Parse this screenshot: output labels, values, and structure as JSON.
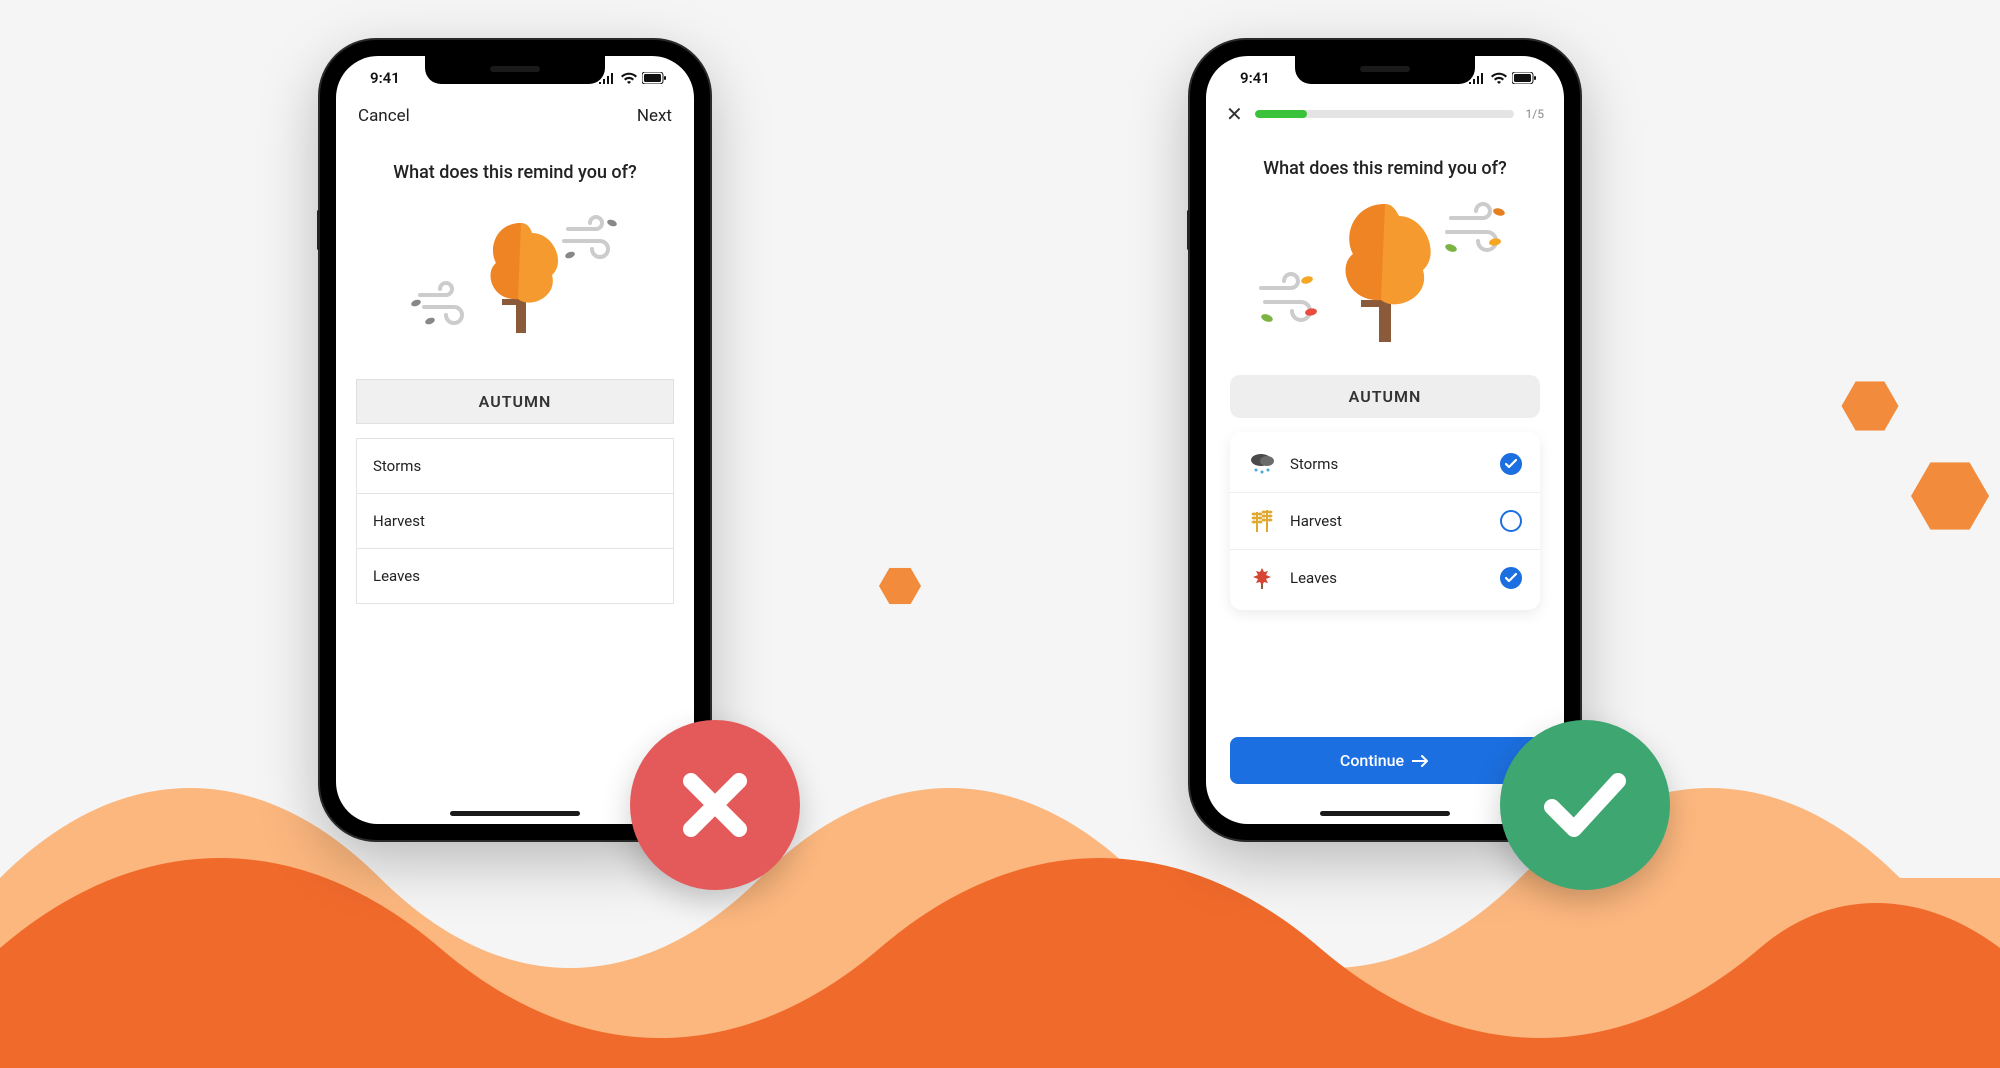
{
  "status": {
    "time": "9:41"
  },
  "left": {
    "nav": {
      "cancel": "Cancel",
      "next": "Next"
    },
    "question": "What does this remind you of?",
    "section": "AUTUMN",
    "options": [
      {
        "label": "Storms"
      },
      {
        "label": "Harvest"
      },
      {
        "label": "Leaves"
      }
    ]
  },
  "right": {
    "progress": {
      "label": "1/5",
      "percent": 20
    },
    "question": "What does this remind you of?",
    "section": "AUTUMN",
    "options": [
      {
        "label": "Storms",
        "checked": true
      },
      {
        "label": "Harvest",
        "checked": false
      },
      {
        "label": "Leaves",
        "checked": true
      }
    ],
    "cta": "Continue"
  },
  "palette": {
    "accent": "#1c6fe0",
    "green": "#3ac23a",
    "orangeDark": "#f06a2b",
    "orangeLight": "#fcb77e",
    "bad": "#e45a5a",
    "good": "#3da671"
  }
}
